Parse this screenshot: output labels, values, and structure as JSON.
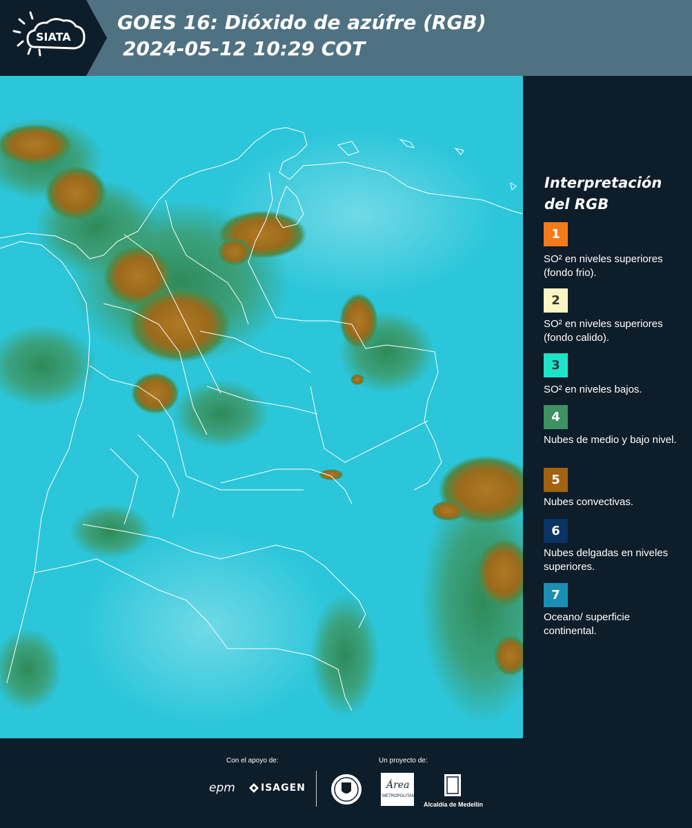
{
  "header": {
    "logo_text": "SIATA",
    "title_line1": "GOES 16: Dióxido de azúfre (RGB)",
    "title_line2": "2024-05-12 10:29 COT"
  },
  "legend": {
    "title_line1": "Interpretación",
    "title_line2": "del RGB",
    "items": [
      {
        "number": "1",
        "color": "#f47b1c",
        "text_color": "#ffffff",
        "label": "SO² en niveles superiores (fondo frio)."
      },
      {
        "number": "2",
        "color": "#fdf5c2",
        "text_color": "#333333",
        "label": "SO² en niveles superiores (fondo calido)."
      },
      {
        "number": "3",
        "color": "#1fe3c8",
        "text_color": "#1e3a40",
        "label": "SO² en niveles bajos."
      },
      {
        "number": "4",
        "color": "#3e9163",
        "text_color": "#ffffff",
        "label": "Nubes de medio y bajo nivel."
      },
      {
        "number": "5",
        "color": "#a26212",
        "text_color": "#ffffff",
        "label": "Nubes convectivas."
      },
      {
        "number": "6",
        "color": "#0b3364",
        "text_color": "#ffffff",
        "label": "Nubes delgadas en niveles superiores."
      },
      {
        "number": "7",
        "color": "#1b8fb3",
        "text_color": "#ffffff",
        "label": "Oceano/ superficie continental."
      }
    ]
  },
  "footer": {
    "support_label": "Con el apoyo de:",
    "project_label": "Un proyecto de:",
    "sponsors": [
      "epm",
      "ISAGEN"
    ],
    "partners": [
      "Área Metropolitana Valle de Aburrá",
      "Alcaldía de Medellín"
    ],
    "partner_area_name": "Área",
    "partner_area_sub": "METROPOLITANA",
    "partner_alcaldia": "Alcaldía de Medellín"
  },
  "map": {
    "colors": {
      "ocean": "#26c6d8",
      "cloud_low": "#3e9163",
      "cloud_convective": "#a06a1a",
      "border": "#ffffff"
    }
  }
}
